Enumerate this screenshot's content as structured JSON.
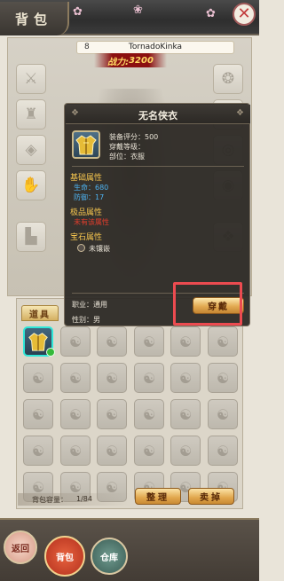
{
  "header": {
    "title": "背包",
    "close_label": "✕"
  },
  "character": {
    "level": "8",
    "name": "TornadoKinka",
    "power_label": "战力:",
    "power_value": "3200"
  },
  "tooltip": {
    "title": "无名侠衣",
    "score_label": "装备评分：",
    "score_value": "500",
    "level_label": "穿戴等级：",
    "level_value": "",
    "slot_label": "部位：",
    "slot_value": "衣服",
    "base_attr_label": "基础属性",
    "stats": [
      {
        "label": "生命：",
        "value": "680"
      },
      {
        "label": "防御：",
        "value": "17"
      }
    ],
    "quality_label": "极品属性",
    "quality_none": "未有该属性",
    "gem_label": "宝石属性",
    "gem_none": "未镶嵌",
    "job_label": "职业：",
    "job_value": "通用",
    "gender_label": "性别：",
    "gender_value": "男",
    "equip_button": "穿戴"
  },
  "bag": {
    "tab_label": "道具",
    "capacity_label": "背包容量：",
    "capacity_value": "1/84",
    "sort_button": "整理",
    "sell_button": "卖掉"
  },
  "nav": {
    "back_label": "返回",
    "bag_label": "背包",
    "warehouse_label": "仓库"
  },
  "colors": {
    "highlight": "#ec4b50",
    "power_text": "#ffd864",
    "item_border": "#2fe7d8",
    "stat_text": "#4db2f0",
    "section_text": "#f4c44e"
  }
}
